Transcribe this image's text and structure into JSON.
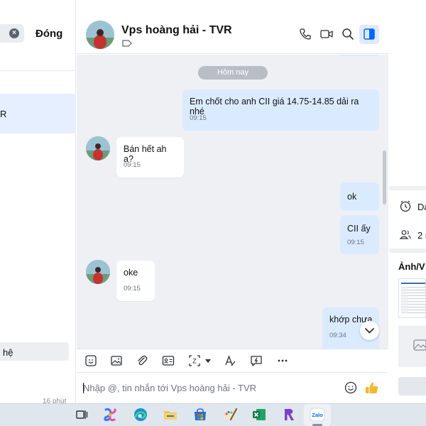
{
  "left_panel": {
    "close_label": "Đóng",
    "selected_conversation_fragment": "R",
    "contact_section_fragment": "hệ",
    "last_date_fragment": "16 phút"
  },
  "header": {
    "title": "Vps hoàng hải - TVR"
  },
  "messages": {
    "date_divider": "Hôm nay",
    "items": [
      {
        "direction": "out",
        "text": "Em chốt cho anh CII giá 14.75-14.85 dải ra nhé",
        "time": "09:15"
      },
      {
        "direction": "in",
        "text": "Bán hết ah a?",
        "time": "09:15"
      },
      {
        "direction": "out",
        "text": "ok",
        "time": ""
      },
      {
        "direction": "out",
        "text": "CII ấy",
        "time": "09:15"
      },
      {
        "direction": "in",
        "text": "oke",
        "time": "09:15"
      },
      {
        "direction": "out",
        "text": "khớp chưa",
        "time": "09:34"
      }
    ]
  },
  "composer": {
    "placeholder": "Nhập @, tin nhắn tới Vps hoàng hải - TVR"
  },
  "right_panel": {
    "reminder_fragment": "Da",
    "members_fragment": "2 n",
    "media_title_fragment": "Ảnh/V"
  },
  "taskbar": {
    "zalo_label": "Zalo"
  },
  "colors": {
    "accent": "#0068ff",
    "outgoing_bubble": "#dbebff",
    "chat_background": "#eef0f3",
    "thumb_up": "#f5b82e"
  }
}
